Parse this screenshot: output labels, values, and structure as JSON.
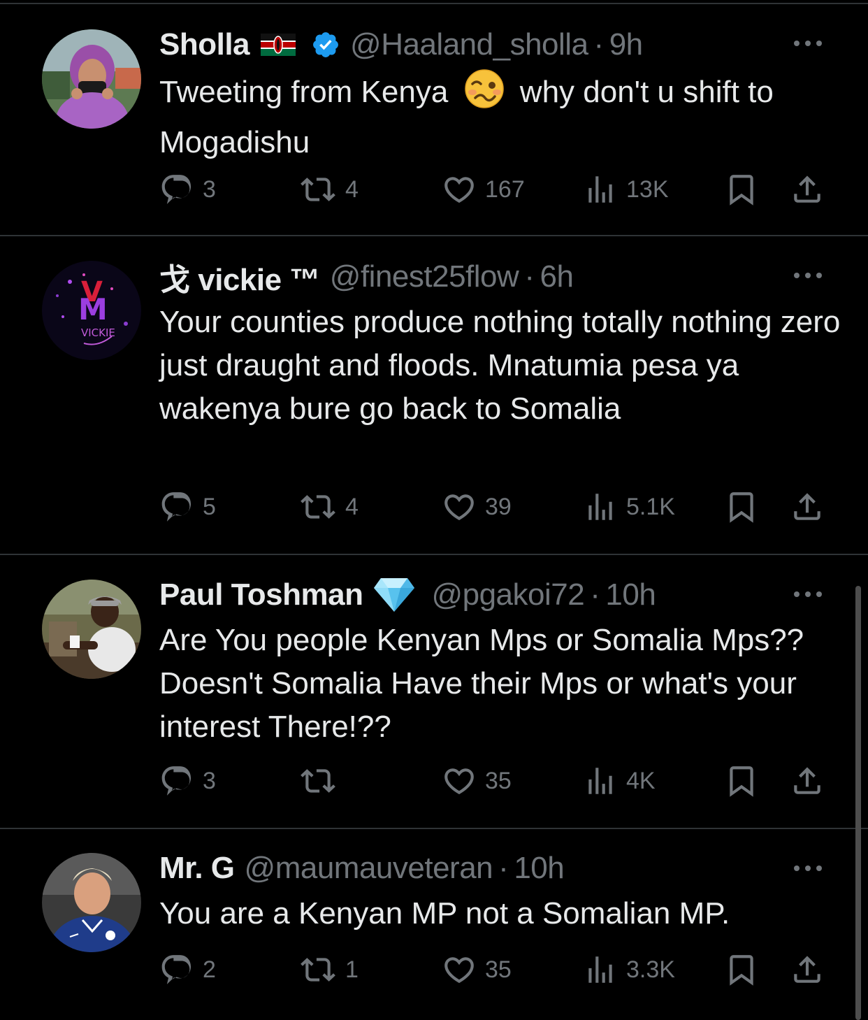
{
  "tweets": [
    {
      "name": "Sholla",
      "handle": "@Haaland_sholla",
      "separator": "·",
      "time": "9h",
      "text_before_emoji": "Tweeting from Kenya",
      "text_after_emoji": "why don't u shift to Mogadishu",
      "badges": [
        "kenya-flag-icon",
        "verified-badge-icon"
      ],
      "replies": "3",
      "retweets": "4",
      "likes": "167",
      "views": "13K"
    },
    {
      "name": "戈 vickie ™",
      "handle": "@finest25flow",
      "separator": "·",
      "time": "6h",
      "text": "Your counties produce nothing totally nothing zero just draught and floods. Mnatumia pesa ya wakenya bure go back to Somalia",
      "replies": "5",
      "retweets": "4",
      "likes": "39",
      "views": "5.1K"
    },
    {
      "name": "Paul Toshman",
      "handle": "@pgakoi72",
      "separator": "·",
      "time": "10h",
      "text": "Are You people Kenyan Mps or Somalia Mps?? Doesn't Somalia Have their Mps or what's your interest There!??",
      "badges": [
        "diamond-icon"
      ],
      "replies": "3",
      "retweets": "",
      "likes": "35",
      "views": "4K"
    },
    {
      "name": "Mr. G",
      "handle": "@maumauveteran",
      "separator": "·",
      "time": "10h",
      "text": "You are a Kenyan MP not a Somalian MP.",
      "replies": "2",
      "retweets": "1",
      "likes": "35",
      "views": "3.3K"
    }
  ],
  "colors": {
    "background": "#000000",
    "text": "#e7e9ea",
    "muted": "#71767b",
    "divider": "#2f3336",
    "verified": "#1d9bf0"
  }
}
